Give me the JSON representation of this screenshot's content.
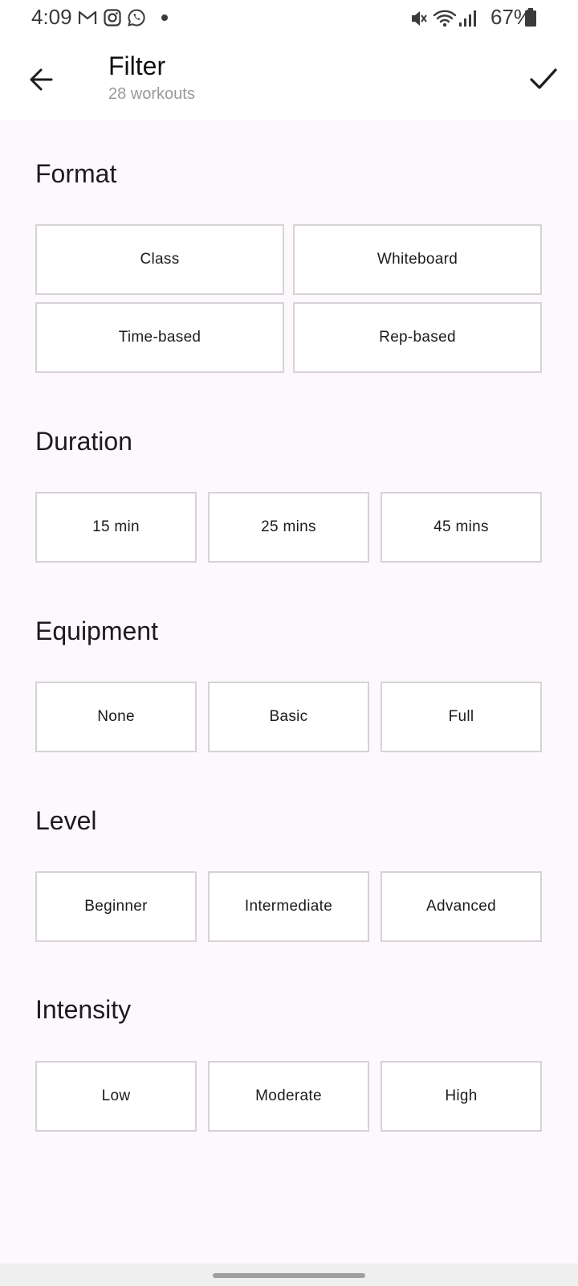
{
  "status_bar": {
    "time": "4:09",
    "battery": "67%",
    "left_icons": [
      "gmail-icon",
      "instagram-icon",
      "whatsapp-icon"
    ],
    "right_icons": [
      "mute-icon",
      "wifi-icon",
      "signal-icon",
      "battery-icon"
    ]
  },
  "header": {
    "title": "Filter",
    "subtitle": "28 workouts",
    "back_icon": "arrow-back-icon",
    "apply_icon": "check-icon"
  },
  "sections": {
    "format": {
      "title": "Format",
      "options": [
        "Class",
        "Whiteboard",
        "Time-based",
        "Rep-based"
      ]
    },
    "duration": {
      "title": "Duration",
      "options": [
        "15 min",
        "25 mins",
        "45 mins"
      ]
    },
    "equipment": {
      "title": "Equipment",
      "options": [
        "None",
        "Basic",
        "Full"
      ]
    },
    "level": {
      "title": "Level",
      "options": [
        "Beginner",
        "Intermediate",
        "Advanced"
      ]
    },
    "intensity": {
      "title": "Intensity",
      "options": [
        "Low",
        "Moderate",
        "High"
      ]
    }
  },
  "colors": {
    "background": "#fdf8fc",
    "chip_border": "#d6d2d8",
    "chip_fill": "#ffffff",
    "text": "#1c1b1f",
    "subtitle": "#9a9a9a"
  }
}
